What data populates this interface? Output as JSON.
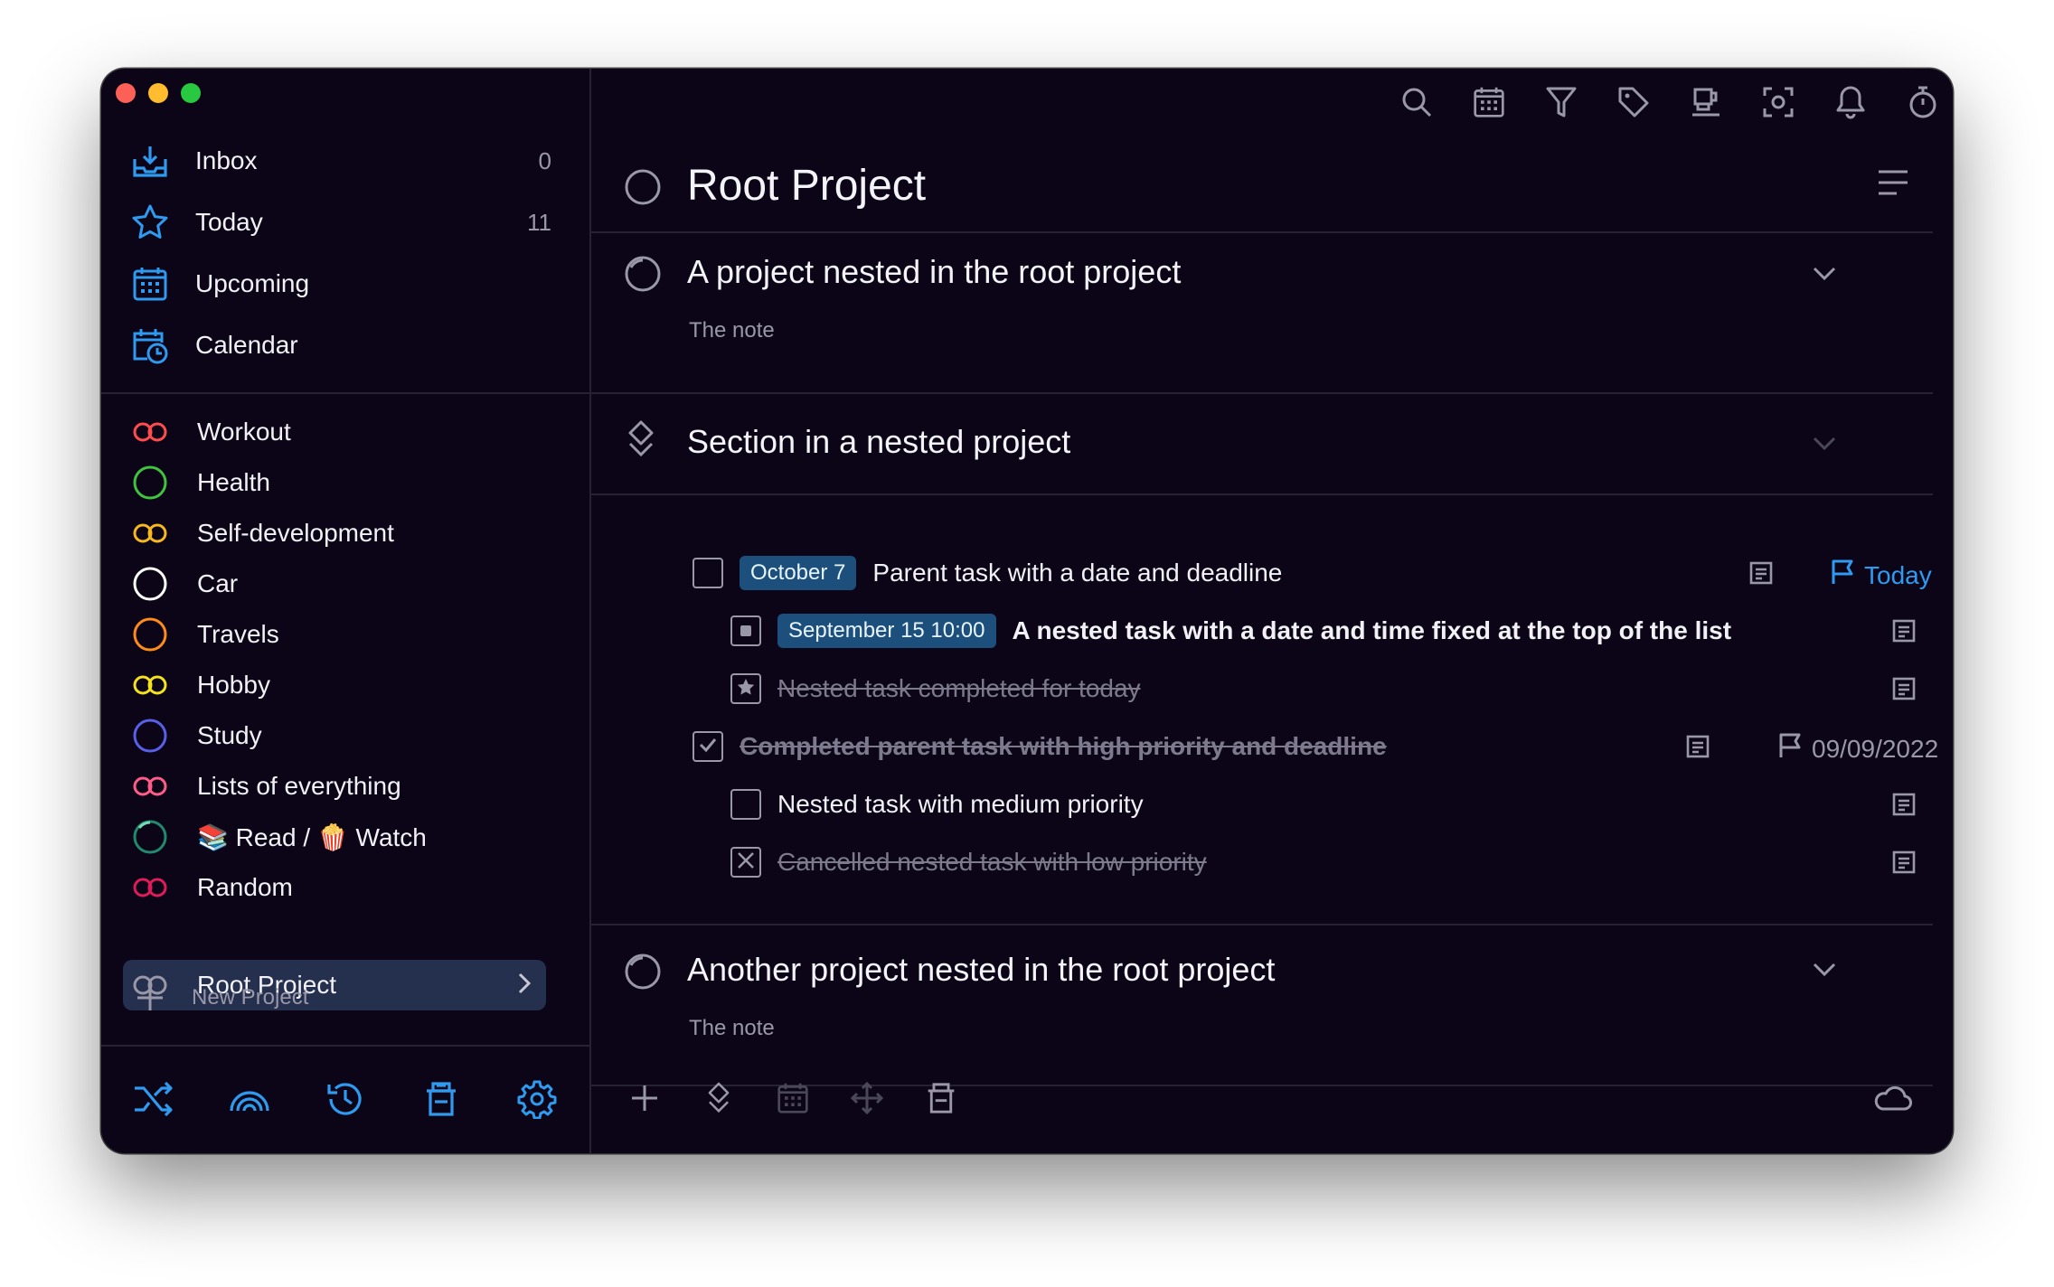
{
  "sidebar": {
    "nav": [
      {
        "label": "Inbox",
        "count": "0",
        "icon": "inbox-icon"
      },
      {
        "label": "Today",
        "count": "11",
        "icon": "star-icon"
      },
      {
        "label": "Upcoming",
        "count": "",
        "icon": "calendar-grid-icon"
      },
      {
        "label": "Calendar",
        "count": "",
        "icon": "calendar-clock-icon"
      }
    ],
    "projects": [
      {
        "label": "Workout",
        "color": "#ff4d4d",
        "icon": "infinity-icon"
      },
      {
        "label": "Health",
        "color": "#3ec43e",
        "icon": "circle-icon"
      },
      {
        "label": "Self-development",
        "color": "#f6b81c",
        "icon": "infinity-icon"
      },
      {
        "label": "Car",
        "color": "#ffffff",
        "icon": "circle-icon"
      },
      {
        "label": "Travels",
        "color": "#ff8c1a",
        "icon": "circle-icon"
      },
      {
        "label": "Hobby",
        "color": "#f5e21a",
        "icon": "infinity-icon"
      },
      {
        "label": "Study",
        "color": "#5960e8",
        "icon": "circle-icon"
      },
      {
        "label": "Lists of everything",
        "color": "#ff5c8a",
        "icon": "infinity-icon"
      },
      {
        "label": "📚 Read / 🍿 Watch",
        "color": "#1f8a6e",
        "icon": "progress-circle-icon"
      },
      {
        "label": "Random",
        "color": "#e01b5a",
        "icon": "infinity-icon"
      },
      {
        "label": "Root Project",
        "color": "#9a98a8",
        "icon": "infinity-icon"
      }
    ],
    "new_project_label": "New Project"
  },
  "main": {
    "title": "Root Project",
    "blocks": {
      "nested_project_1": {
        "title": "A project nested in the root project",
        "note": "The note"
      },
      "section": {
        "title": "Section in a nested project"
      },
      "nested_project_2": {
        "title": "Another project nested in the root project",
        "note": "The note"
      }
    },
    "tasks": {
      "t1": {
        "date": "October 7",
        "text": "Parent task with a date and deadline",
        "deadline": "Today"
      },
      "t2": {
        "date": "September 15 10:00",
        "text": "A nested task with a date and time fixed at the top of the list"
      },
      "t3": {
        "text": "Nested task completed for today"
      },
      "t4": {
        "text": "Completed parent task with high priority and deadline",
        "deadline": "09/09/2022"
      },
      "t5": {
        "text": "Nested task with medium priority"
      },
      "t6": {
        "text": "Cancelled nested task with low priority"
      }
    }
  },
  "colors": {
    "accent": "#2e9bf0",
    "background": "#0b0517",
    "selected": "#24304e"
  }
}
